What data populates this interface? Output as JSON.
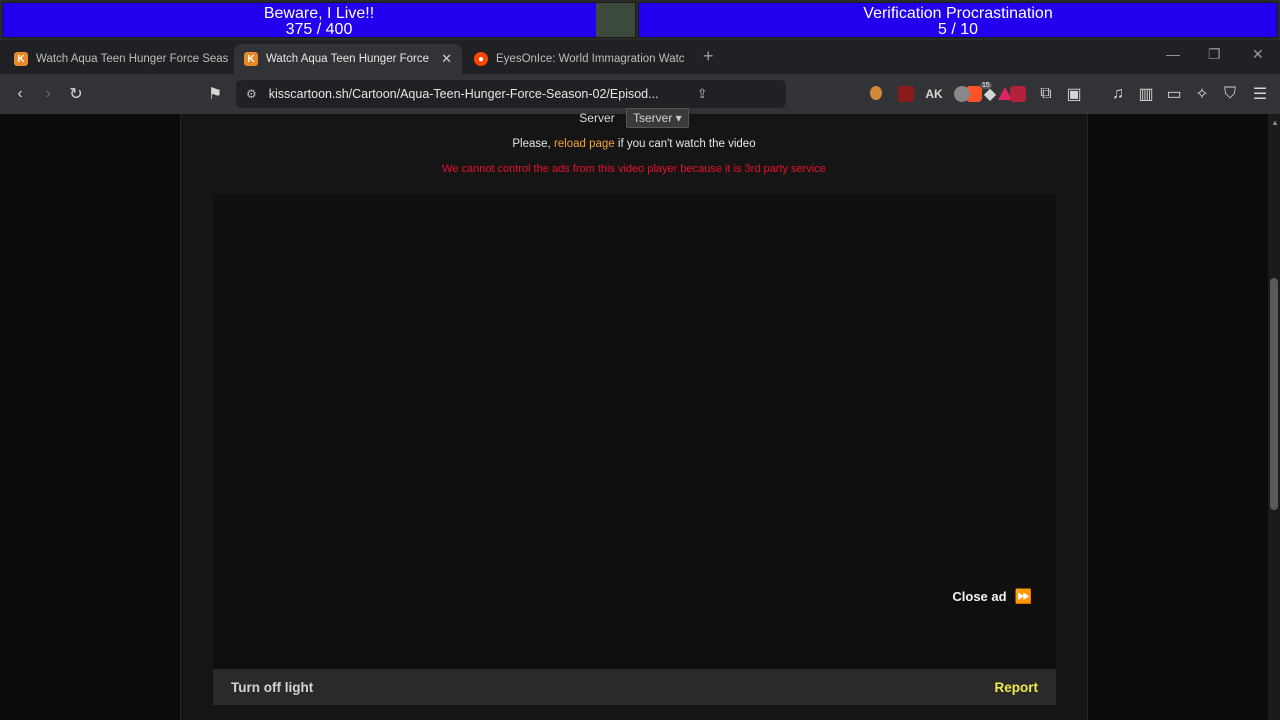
{
  "overlay": {
    "bar1": {
      "title": "Beware, I Live!!",
      "count": "375 / 400",
      "progress": 0.9375
    },
    "bar2": {
      "title": "Verification Procrastination",
      "count": "5 / 10",
      "progress": 1.0
    }
  },
  "tabs": [
    {
      "title": "Watch Aqua Teen Hunger Force Seas",
      "favicon": "K",
      "active": false
    },
    {
      "title": "Watch Aqua Teen Hunger Force",
      "favicon": "K",
      "active": true
    },
    {
      "title": "EyesOnIce: World Immagration Watc",
      "favicon": "reddit-icon",
      "active": false
    }
  ],
  "toolbar": {
    "url": "kisscartoon.sh/Cartoon/Aqua-Teen-Hunger-Force-Season-02/Episod...",
    "brave_count": "15"
  },
  "page": {
    "server_label": "Server",
    "server_value": "Tserver",
    "reload_prefix": "Please, ",
    "reload_link": "reload page",
    "reload_suffix": " if you can't watch the video",
    "warning": "We cannot control the ads from this video player because it is 3rd party service",
    "close_ad": "Close ad",
    "turn_off_light": "Turn off light",
    "report": "Report"
  },
  "colors": {
    "progress_fill": "#2200ee",
    "warning": "#e8102a",
    "reload_link": "#f0a33a",
    "report": "#f2e84b"
  }
}
